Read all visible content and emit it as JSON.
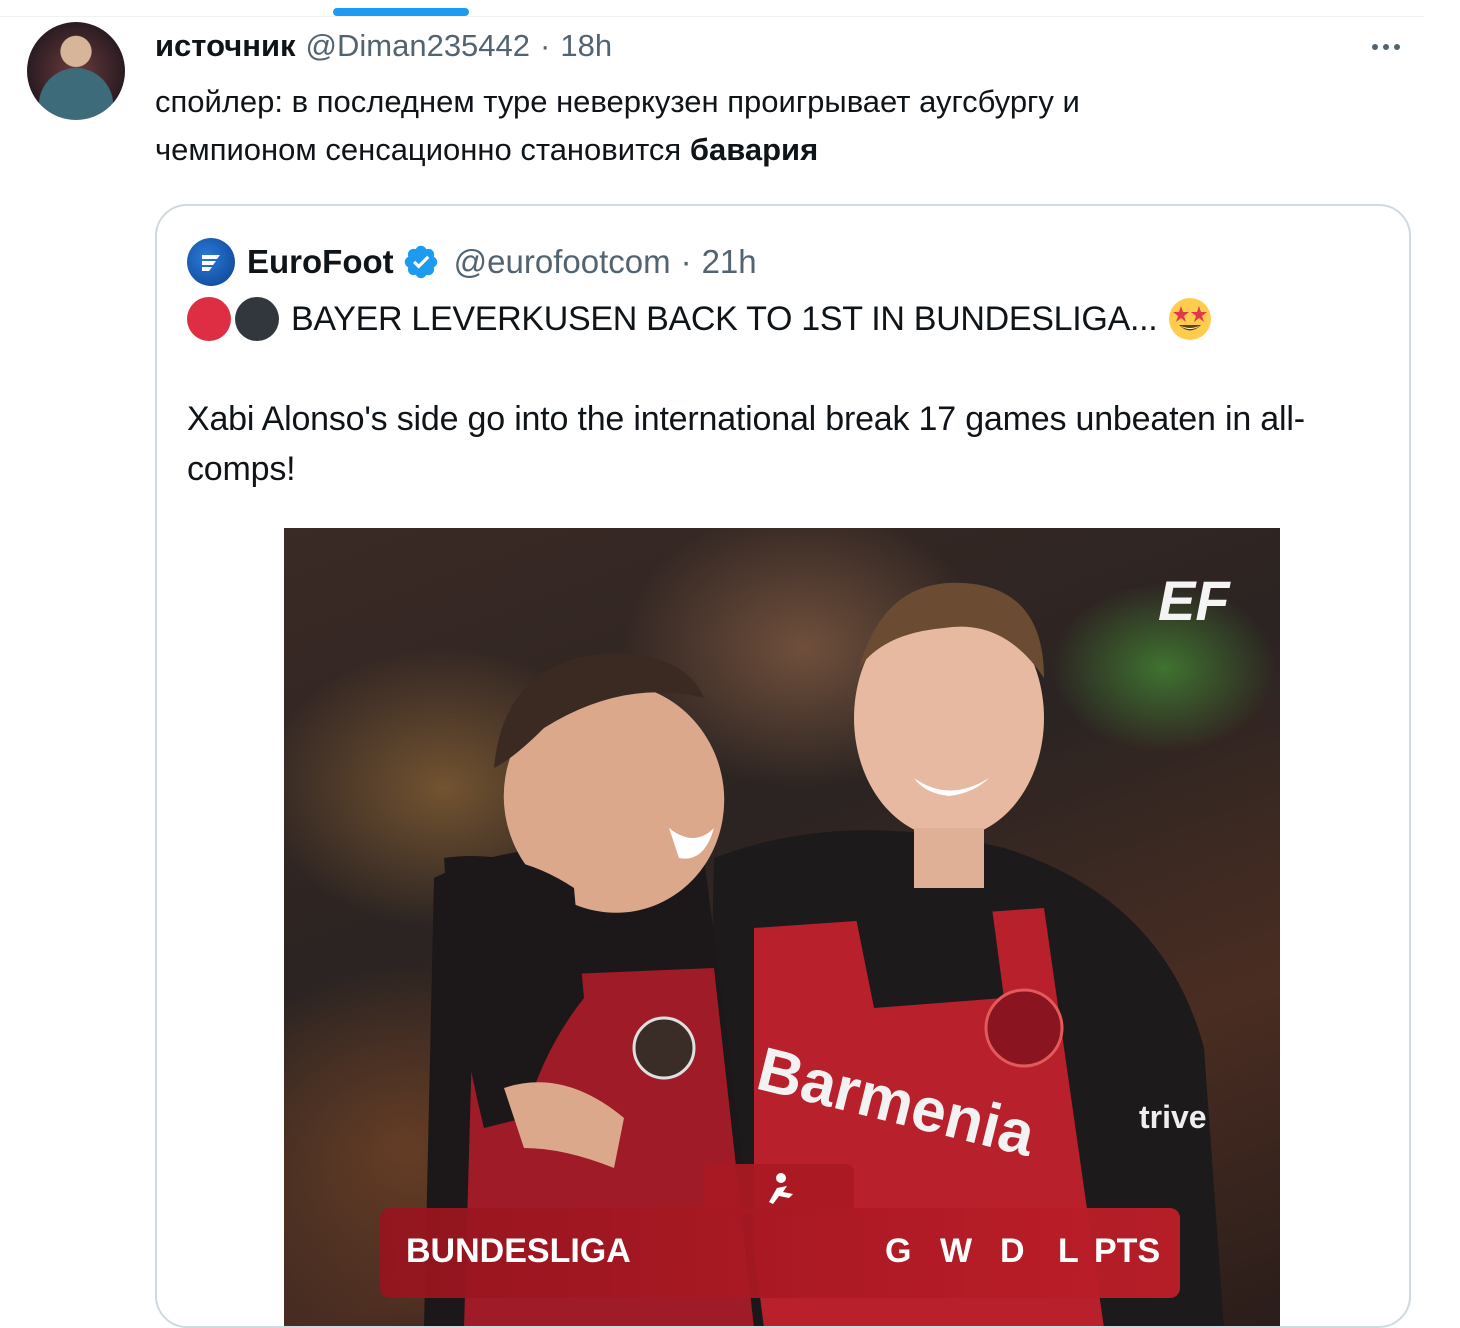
{
  "tweet": {
    "author_name": "источник",
    "handle": "@Diman235442",
    "separator": "·",
    "time": "18h",
    "text_line1": "спойлер: в последнем туре неверкузен проигрывает аугсбургу и",
    "text_line2_plain": "чемпионом сенсационно становится ",
    "text_line2_bold": "бавария"
  },
  "quote": {
    "author_name": "EuroFoot",
    "handle": "@eurofootcom",
    "separator": "·",
    "time": "21h",
    "line1": "BAYER LEVERKUSEN BACK TO 1ST IN BUNDESLIGA...",
    "line2": "Xabi Alonso's side go into the international break 17 games unbeaten in all-comps!",
    "media": {
      "watermark": "EF",
      "jersey_text": "Barmenia",
      "sponsor_text": "trive",
      "table": {
        "title": "BUNDESLIGA",
        "columns": [
          "G",
          "W",
          "D",
          "L",
          "PTS"
        ]
      }
    }
  },
  "colors": {
    "accent": "#1d9bf0",
    "text": "#0f1419",
    "secondary_text": "#536471",
    "border": "#cfd9de",
    "bar_red": "#b41e28"
  },
  "icons": [
    "more-icon",
    "verified-icon",
    "red-circle-emoji",
    "black-circle-emoji",
    "star-struck-emoji",
    "bundesliga-logo-icon"
  ]
}
